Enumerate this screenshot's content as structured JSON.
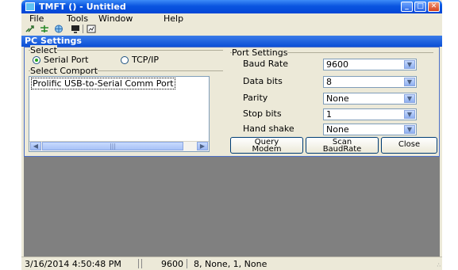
{
  "window": {
    "title": "TMFT () - Untitled",
    "controls": [
      "_",
      "□",
      "✕"
    ]
  },
  "menu": [
    {
      "label": "File"
    },
    {
      "label": "Tools"
    },
    {
      "label": "Window"
    },
    {
      "label": "Help"
    }
  ],
  "toolbar": {
    "icons": [
      "link-icon",
      "tree-icon",
      "globe-icon",
      "monitor-icon",
      "chart-icon"
    ]
  },
  "dialog": {
    "title": "PC Settings",
    "select_group": {
      "label": "Select",
      "serial_label": "Serial Port",
      "tcpip_label": "TCP/IP",
      "selected": "serial"
    },
    "comport_group": {
      "label": "Select Comport",
      "items": [
        "Prolific USB-to-Serial Comm Port"
      ]
    },
    "port_settings": {
      "label": "Port Settings",
      "baud_rate": {
        "label": "Baud Rate",
        "value": "9600"
      },
      "data_bits": {
        "label": "Data bits",
        "value": "8"
      },
      "parity": {
        "label": "Parity",
        "value": "None"
      },
      "stop_bits": {
        "label": "Stop bits",
        "value": "1"
      },
      "hand_shake": {
        "label": "Hand shake",
        "value": "None"
      }
    },
    "buttons": {
      "query_modem": "Query\nModem",
      "scan_baudrate": "Scan\nBaudRate",
      "close": "Close"
    }
  },
  "status": {
    "datetime": "3/16/2014 4:50:48 PM",
    "baud": "9600",
    "format": "8, None, 1, None"
  },
  "colors": {
    "titlebar": "#0a55e0",
    "dialog_face": "#ece9d8",
    "mdi_background": "#808080",
    "radio_dot": "#23a41d"
  }
}
